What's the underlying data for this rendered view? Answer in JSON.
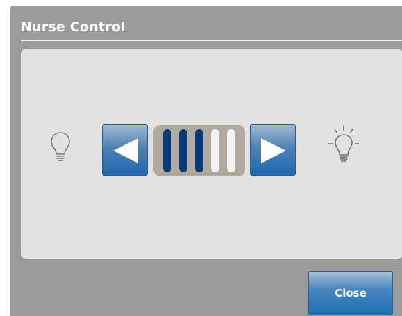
{
  "dialog": {
    "title": "Nurse Control"
  },
  "brightness": {
    "level": 3,
    "max_level": 5,
    "decrease_icon": "left-arrow-icon",
    "increase_icon": "right-arrow-icon",
    "dim_icon": "bulb-off-icon",
    "bright_icon": "bulb-on-icon",
    "on_color": "#063a78",
    "off_color": "#f2f2f2"
  },
  "footer": {
    "close_label": "Close"
  },
  "colors": {
    "accent": "#1d6fb8",
    "dialog_bg": "#9b9b9b",
    "panel_bg": "#e2e2e2"
  }
}
